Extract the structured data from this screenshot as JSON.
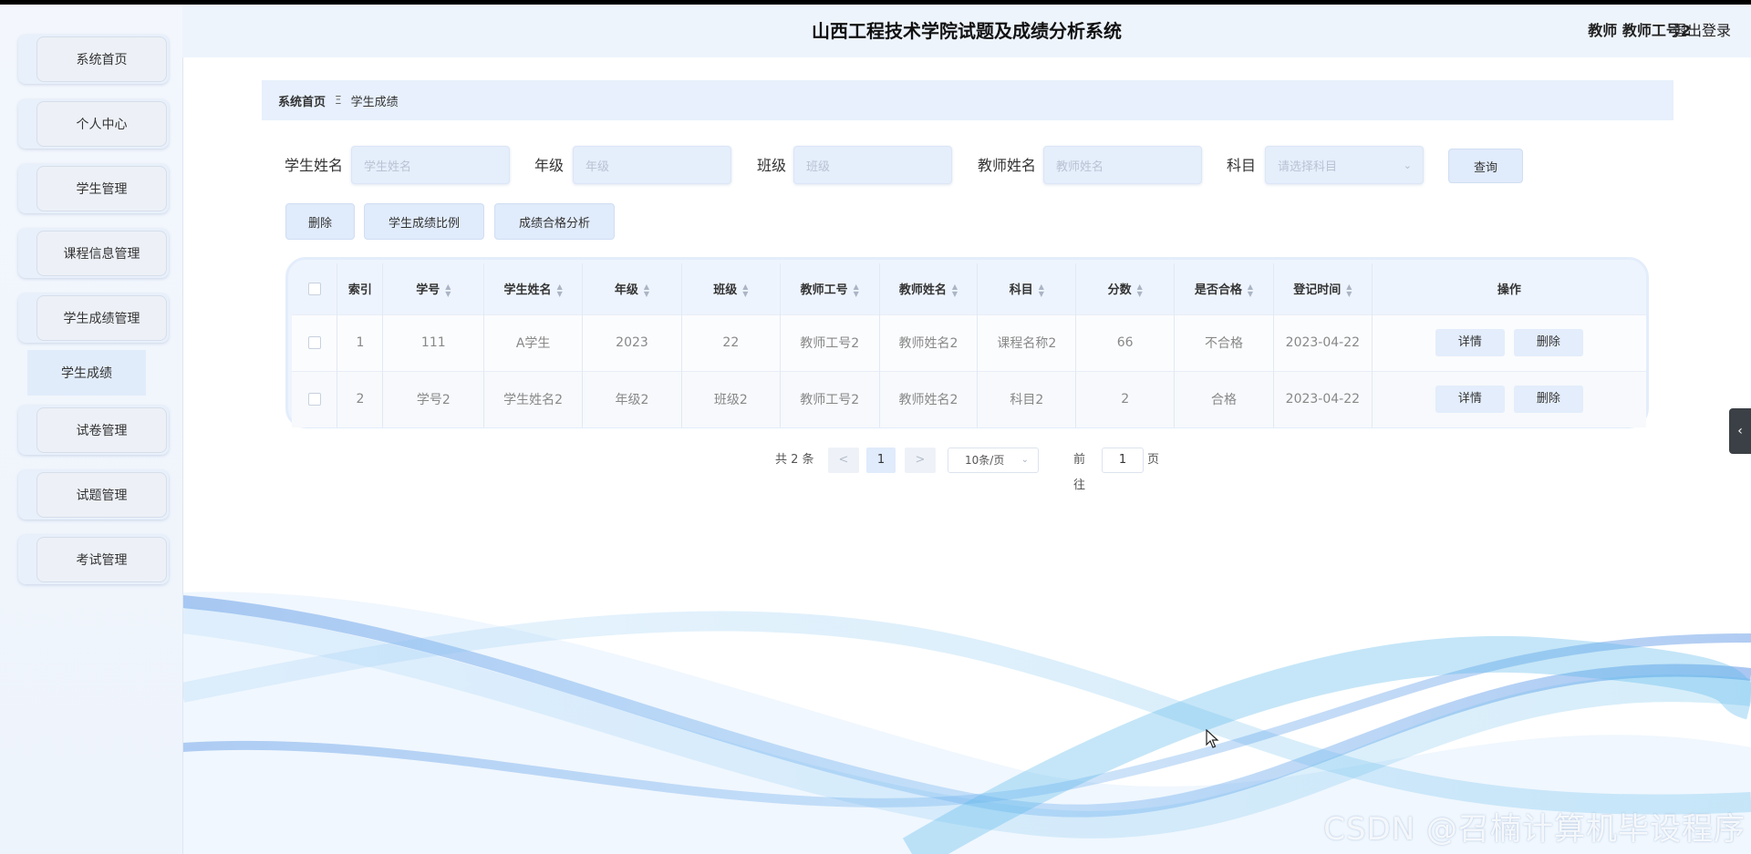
{
  "app": {
    "title": "山西工程技术学院试题及成绩分析系统",
    "user_label": "教师 教师工号2",
    "logout_label": "退出登录"
  },
  "sidebar": {
    "items": [
      {
        "label": "系统首页"
      },
      {
        "label": "个人中心"
      },
      {
        "label": "学生管理"
      },
      {
        "label": "课程信息管理"
      },
      {
        "label": "学生成绩管理"
      },
      {
        "label": "试卷管理"
      },
      {
        "label": "试题管理"
      },
      {
        "label": "考试管理"
      }
    ],
    "active_sub_item": "学生成绩"
  },
  "breadcrumb": {
    "home": "系统首页",
    "separator": "Ξ",
    "current": "学生成绩"
  },
  "search": {
    "fields": [
      {
        "label": "学生姓名",
        "placeholder": "学生姓名",
        "value": ""
      },
      {
        "label": "年级",
        "placeholder": "年级",
        "value": ""
      },
      {
        "label": "班级",
        "placeholder": "班级",
        "value": ""
      },
      {
        "label": "教师姓名",
        "placeholder": "教师姓名",
        "value": ""
      },
      {
        "label": "科目",
        "placeholder": "请选择科目",
        "value": ""
      }
    ],
    "query_label": "查询"
  },
  "actions": {
    "delete_label": "删除",
    "ratio_label": "学生成绩比例",
    "pass_analysis_label": "成绩合格分析"
  },
  "table": {
    "columns": [
      "索引",
      "学号",
      "学生姓名",
      "年级",
      "班级",
      "教师工号",
      "教师姓名",
      "科目",
      "分数",
      "是否合格",
      "登记时间",
      "操作"
    ],
    "rows": [
      {
        "index": "1",
        "student_no": "111",
        "student_name": "A学生",
        "grade": "2023",
        "class": "22",
        "teacher_no": "教师工号2",
        "teacher_name": "教师姓名2",
        "subject": "课程名称2",
        "score": "66",
        "passed": "不合格",
        "time": "2023-04-22"
      },
      {
        "index": "2",
        "student_no": "学号2",
        "student_name": "学生姓名2",
        "grade": "年级2",
        "class": "班级2",
        "teacher_no": "教师工号2",
        "teacher_name": "教师姓名2",
        "subject": "科目2",
        "score": "2",
        "passed": "合格",
        "time": "2023-04-22"
      }
    ],
    "detail_label": "详情",
    "row_delete_label": "删除"
  },
  "pagination": {
    "total_text": "共 2 条",
    "prev": "<",
    "next": ">",
    "current_page": "1",
    "page_size": "10条/页",
    "goto_prefix": "前往",
    "goto_value": "1",
    "goto_suffix": "页"
  },
  "side_tab": {
    "glyph": "‹"
  },
  "watermark": "CSDN @召楠计算机毕设程序",
  "colors": {
    "accent": "#e0ebfb",
    "sidebar_bg": "#eef4fc",
    "wave_blue": "#4a8fe0"
  }
}
